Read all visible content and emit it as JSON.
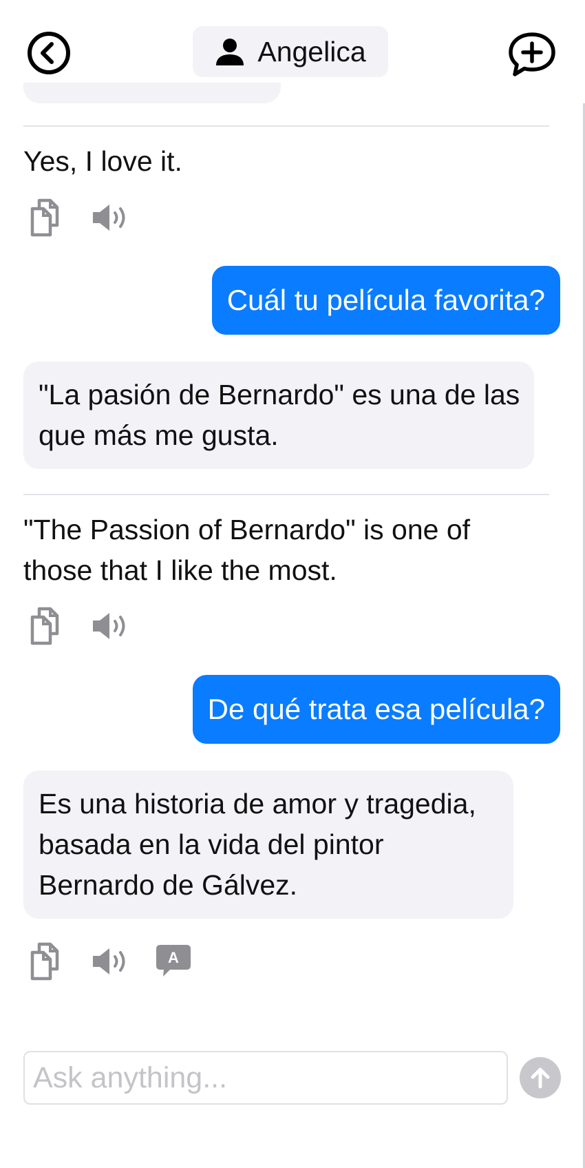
{
  "header": {
    "back_icon": "chevron-left-circle-icon",
    "contact_icon": "person-icon",
    "contact_name": "Angelica",
    "new_chat_icon": "speech-bubble-plus-icon"
  },
  "messages": [
    {
      "role": "assistant",
      "translation": "Yes, I love it.",
      "actions": [
        "copy-icon",
        "speaker-icon"
      ]
    },
    {
      "role": "user",
      "text": "Cuál tu película favorita?"
    },
    {
      "role": "assistant",
      "text": "\"La pasión de Bernardo\" es una de las que más me gusta.",
      "translation": "\"The Passion of Bernardo\" is one of those that I like the most.",
      "actions": [
        "copy-icon",
        "speaker-icon"
      ]
    },
    {
      "role": "user",
      "text": "De qué trata esa película?"
    },
    {
      "role": "assistant",
      "text": "Es una historia de amor y tragedia, basada en la vida del pintor Bernardo de Gálvez.",
      "actions": [
        "copy-icon",
        "speaker-icon",
        "translate-icon"
      ],
      "translate_glyph": "A"
    }
  ],
  "composer": {
    "placeholder": "Ask anything...",
    "value": "",
    "send_icon": "arrow-up-icon"
  },
  "colors": {
    "user_bubble": "#0a7cff",
    "bot_bubble": "#f2f2f7",
    "icon_gray": "#8e8e93",
    "send_disabled": "#c7c7cc"
  }
}
